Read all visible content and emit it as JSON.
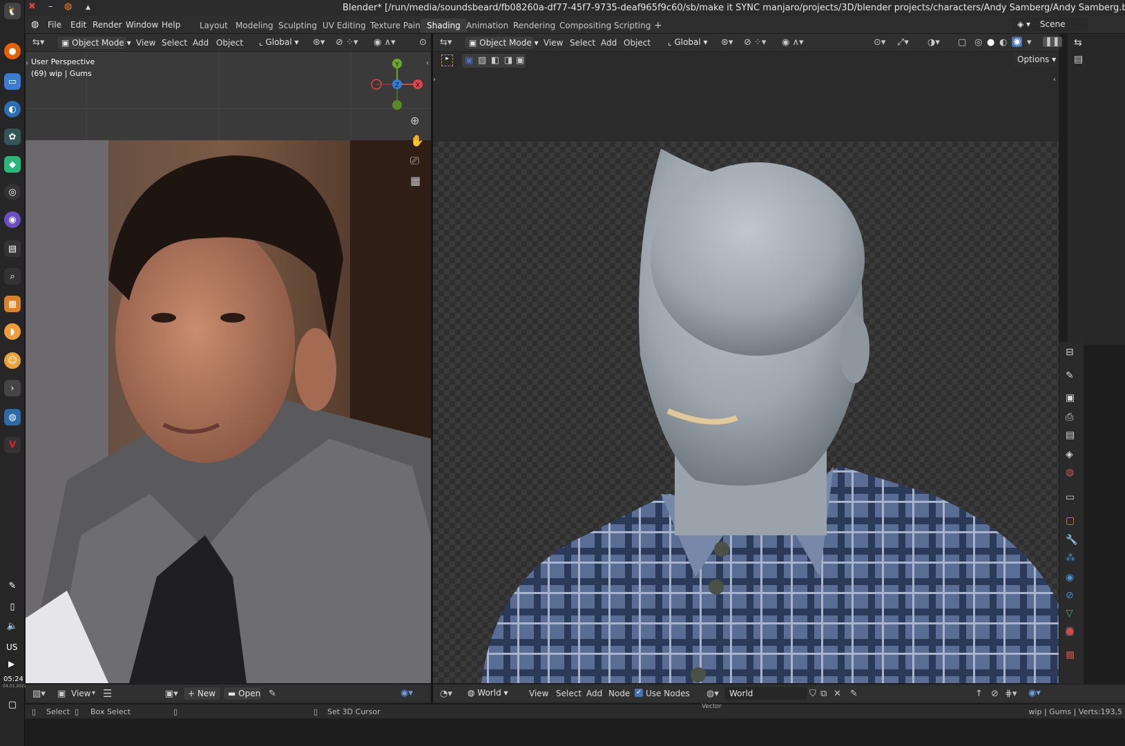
{
  "window": {
    "title": "Blender* [/run/media/soundsbeard/fb08260a-df77-45f7-9735-deaf965f9c60/sb/make it SYNC manjaro/projects/3D/blender projects/characters/Andy Samberg/Andy Samberg.blend]"
  },
  "menu": [
    "File",
    "Edit",
    "Render",
    "Window",
    "Help"
  ],
  "workspaces": [
    "Layout",
    "Modeling",
    "Sculpting",
    "UV Editing",
    "Texture Paint",
    "Shading",
    "Animation",
    "Rendering",
    "Compositing",
    "Scripting"
  ],
  "active_workspace": "Shading",
  "scene_label": "Scene",
  "left_header": {
    "mode": "Object Mode",
    "menus": [
      "View",
      "Select",
      "Add",
      "Object"
    ],
    "orientation": "Global"
  },
  "right_header": {
    "mode": "Object Mode",
    "menus": [
      "View",
      "Select",
      "Add",
      "Object"
    ],
    "orientation": "Global",
    "options": "Options"
  },
  "viewport_left": {
    "persp": "User Perspective",
    "obj": "(69) wip | Gums"
  },
  "gizmo": {
    "x": "X",
    "y": "Y",
    "z": "Z"
  },
  "image_editor": {
    "view": "View",
    "new": "New",
    "open": "Open"
  },
  "node_editor": {
    "world": "World",
    "menus": [
      "View",
      "Select",
      "Add",
      "Node"
    ],
    "use_nodes": "Use Nodes",
    "world_name": "World",
    "vector": "Vector"
  },
  "status": {
    "select": "Select",
    "box_select": "Box Select",
    "cursor": "Set 3D Cursor",
    "info": "wip | Gums | Verts:193,5"
  },
  "dock": {
    "kbd": "US",
    "time": "05:24",
    "date": "04.01.2022"
  },
  "colors": {
    "accent": "#4772b3",
    "x": "#e0414a",
    "y": "#6ba82a",
    "z": "#2e7fd8"
  }
}
